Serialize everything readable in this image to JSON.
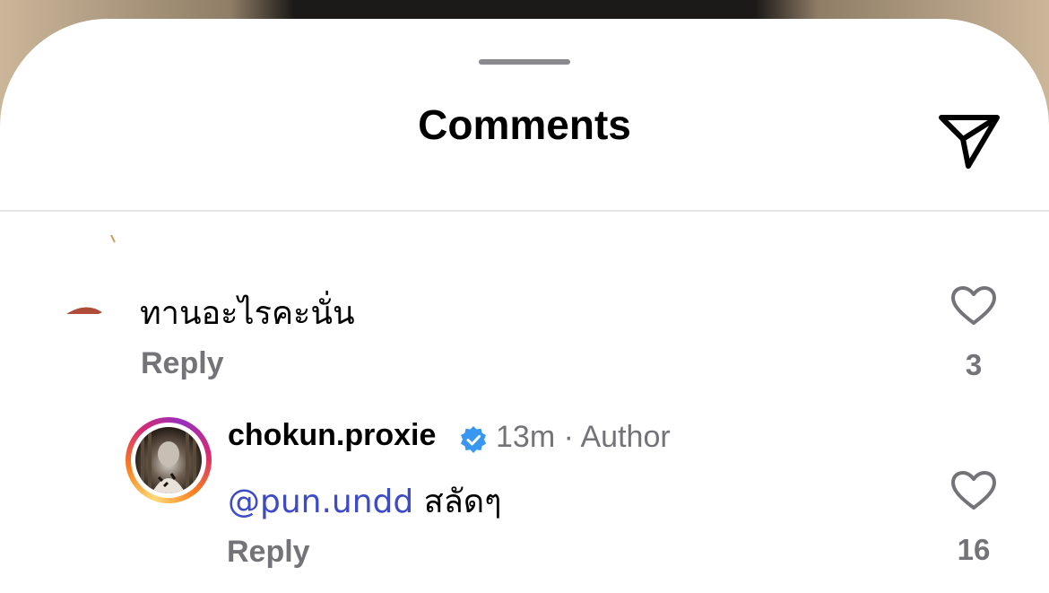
{
  "sheet": {
    "title": "Comments"
  },
  "comments": [
    {
      "text": "ทานอะไรคะนั่น",
      "reply_label": "Reply",
      "likes": "3"
    }
  ],
  "reply": {
    "username": "chokun.proxie",
    "time": "13m",
    "separator": "·",
    "author_label": "Author",
    "mention": "@pun.undd",
    "text": "สลัดๆ",
    "reply_label": "Reply",
    "likes": "16"
  },
  "icons": {
    "share": "paper-plane-icon",
    "like": "heart-outline-icon",
    "verified": "verified-badge-icon"
  },
  "colors": {
    "muted_text": "#737378",
    "mention": "#3d4bc8",
    "verified_blue": "#3897f0"
  }
}
